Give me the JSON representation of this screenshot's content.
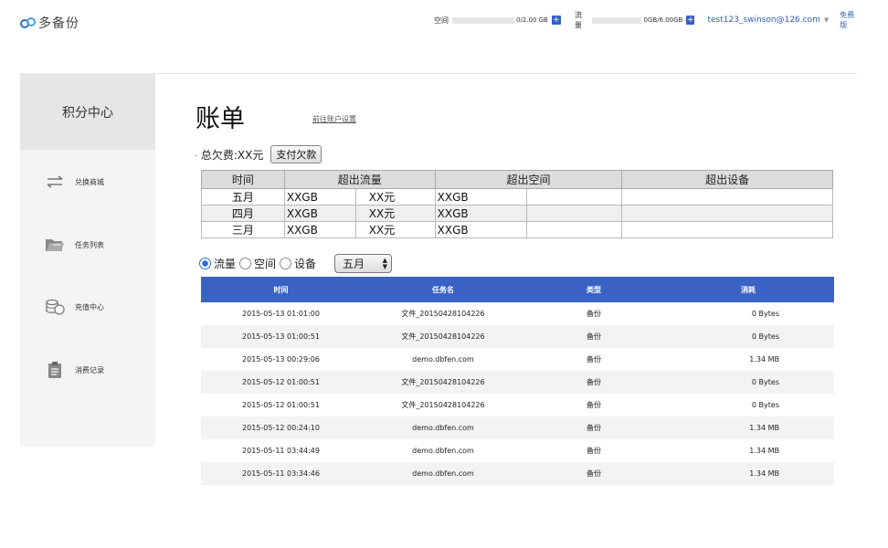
{
  "app": {
    "logo_text": "多备份"
  },
  "topbar": {
    "space_label": "空间",
    "space_value": "0/2.00 GB",
    "space_fraction": 0,
    "traffic_label": "流量",
    "traffic_value": "0GB/6.00GB",
    "traffic_fraction": 0,
    "plus": "+",
    "user_email": "test123_swinson@126.com",
    "free_version": "免费版"
  },
  "sidebar": {
    "title": "积分中心",
    "items": [
      {
        "label": "兑换商城",
        "icon": "exchange-arrows-icon"
      },
      {
        "label": "任务列表",
        "icon": "folder-icon"
      },
      {
        "label": "充值中心",
        "icon": "coins-icon"
      },
      {
        "label": "消费记录",
        "icon": "clipboard-icon"
      }
    ]
  },
  "main": {
    "title": "账单",
    "account_link": "前往账户设置",
    "owe_label": "总欠费:XX元",
    "pay_button": "支付欠款",
    "summary": {
      "headers": [
        "时间",
        "超出流量",
        "超出空间",
        "超出设备"
      ],
      "rows": [
        {
          "month": "五月",
          "traffic": "XXGB",
          "traffic_fee": "XX元",
          "space": "XXGB"
        },
        {
          "month": "四月",
          "traffic": "XXGB",
          "traffic_fee": "XX元",
          "space": "XXGB"
        },
        {
          "month": "三月",
          "traffic": "XXGB",
          "traffic_fee": "XX元",
          "space": "XXGB"
        }
      ]
    },
    "filter": {
      "options": [
        "流量",
        "空间",
        "设备"
      ],
      "selected": "流量",
      "month_selected": "五月"
    },
    "records": {
      "headers": [
        "时间",
        "任务名",
        "类型",
        "消耗"
      ],
      "rows": [
        {
          "time": "2015-05-13 01:01:00",
          "task": "文件_20150428104226",
          "type": "备份",
          "cost": "0 Bytes"
        },
        {
          "time": "2015-05-13 01:00:51",
          "task": "文件_20150428104226",
          "type": "备份",
          "cost": "0 Bytes"
        },
        {
          "time": "2015-05-13 00:29:06",
          "task": "demo.dbfen.com",
          "type": "备份",
          "cost": "1.34 MB"
        },
        {
          "time": "2015-05-12 01:00:51",
          "task": "文件_20150428104226",
          "type": "备份",
          "cost": "0 Bytes"
        },
        {
          "time": "2015-05-12 01:00:51",
          "task": "文件_20150428104226",
          "type": "备份",
          "cost": "0 Bytes"
        },
        {
          "time": "2015-05-12 00:24:10",
          "task": "demo.dbfen.com",
          "type": "备份",
          "cost": "1.34 MB"
        },
        {
          "time": "2015-05-11 03:44:49",
          "task": "demo.dbfen.com",
          "type": "备份",
          "cost": "1.34 MB"
        },
        {
          "time": "2015-05-11 03:34:46",
          "task": "demo.dbfen.com",
          "type": "备份",
          "cost": "1.34 MB"
        }
      ]
    }
  },
  "colors": {
    "accent": "#3a62c4",
    "link": "#2d5fb8",
    "sidebar_bg": "#f4f4f4",
    "sidebar_head_bg": "#e6e6e6"
  }
}
